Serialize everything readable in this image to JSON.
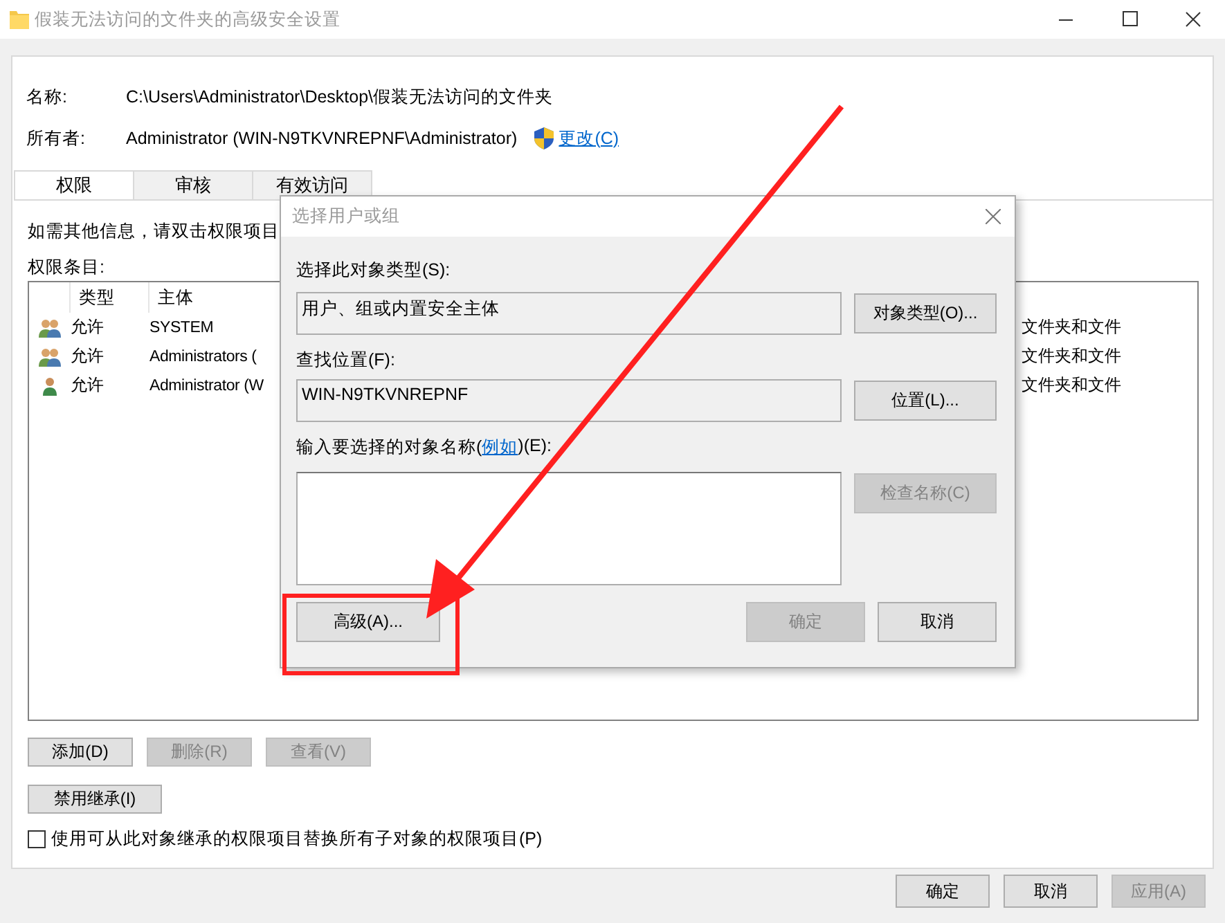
{
  "window": {
    "title": "假装无法访问的文件夹的高级安全设置"
  },
  "name_label": "名称:",
  "name_value": "C:\\Users\\Administrator\\Desktop\\假装无法访问的文件夹",
  "owner_label": "所有者:",
  "owner_value": "Administrator (WIN-N9TKVNREPNF\\Administrator)",
  "change_link": "更改(C)",
  "tabs": [
    {
      "label": "权限",
      "selected": true
    },
    {
      "label": "审核",
      "selected": false
    },
    {
      "label": "有效访问",
      "selected": false
    }
  ],
  "info_text": "如需其他信息，请双击权限项目",
  "entries_label": "权限条目:",
  "table": {
    "columns": [
      "类型",
      "主体"
    ],
    "rows": [
      {
        "kind": "group",
        "type": "允许",
        "principal": "SYSTEM",
        "applies_to": "文件夹和文件"
      },
      {
        "kind": "group",
        "type": "允许",
        "principal": "Administrators (",
        "applies_to": "文件夹和文件"
      },
      {
        "kind": "user",
        "type": "允许",
        "principal": "Administrator (W",
        "applies_to": "文件夹和文件"
      }
    ]
  },
  "buttons": [
    {
      "label": "添加(D)",
      "disabled": false
    },
    {
      "label": "删除(R)",
      "disabled": true
    },
    {
      "label": "查看(V)",
      "disabled": true
    }
  ],
  "inherit_button": "禁用继承(I)",
  "replace_checkbox": {
    "label": "使用可从此对象继承的权限项目替换所有子对象的权限项目(P)",
    "checked": false
  },
  "footer_buttons": [
    {
      "label": "确定",
      "disabled": false
    },
    {
      "label": "取消",
      "disabled": false
    },
    {
      "label": "应用(A)",
      "disabled": true
    }
  ],
  "dialog": {
    "title": "选择用户或组",
    "object_type_label": "选择此对象类型(S):",
    "object_type_value": "用户、组或内置安全主体",
    "object_type_button": "对象类型(O)...",
    "location_label": "查找位置(F):",
    "location_value": "WIN-N9TKVNREPNF",
    "location_button": "位置(L)...",
    "names_label_before": "输入要选择的对象名称(",
    "examples_link": "例如",
    "names_label_after": ")(E):",
    "check_names_button": {
      "label": "检查名称(C)",
      "disabled": true
    },
    "advanced_button": "高级(A)...",
    "ok_button": {
      "label": "确定",
      "disabled": true
    },
    "cancel_button": {
      "label": "取消",
      "disabled": false
    }
  }
}
